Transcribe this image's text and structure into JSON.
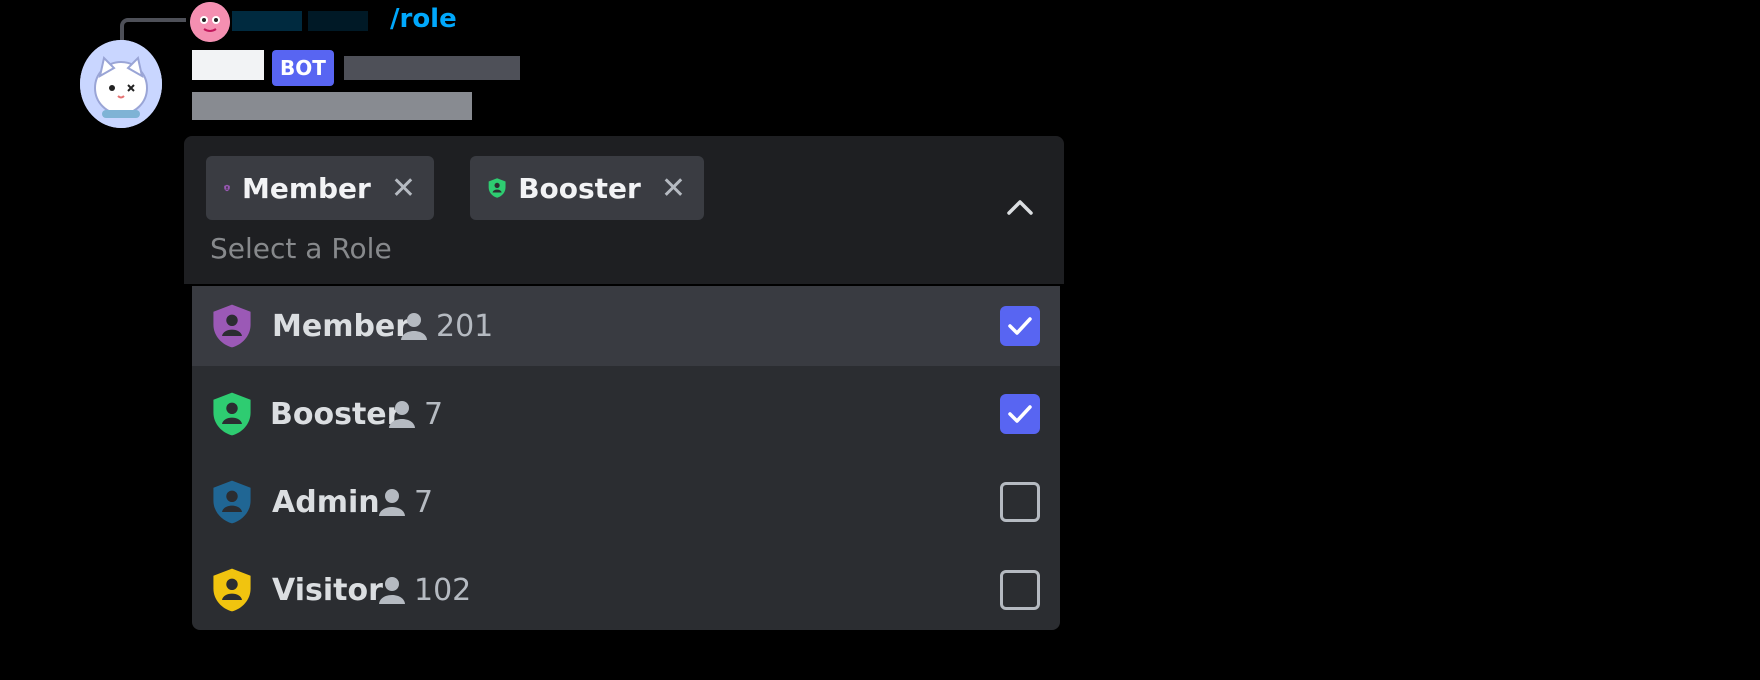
{
  "reply": {
    "command": "/role"
  },
  "message": {
    "bot_tag": "BOT"
  },
  "select": {
    "chips": [
      {
        "label": "Member",
        "color": "#9b59b6"
      },
      {
        "label": "Booster",
        "color": "#2ecc71"
      }
    ],
    "placeholder": "Select a Role",
    "remove_glyph": "✕"
  },
  "options": [
    {
      "name": "Member",
      "count": "201",
      "color": "#9b59b6",
      "checked": true
    },
    {
      "name": "Booster",
      "count": "7",
      "color": "#2ecc71",
      "checked": true
    },
    {
      "name": "Admin",
      "count": "7",
      "color": "#206694",
      "checked": false
    },
    {
      "name": "Visitor",
      "count": "102",
      "color": "#f1c40f",
      "checked": false
    }
  ],
  "icons": [
    "shield-user-icon",
    "user-icon",
    "close-icon",
    "chevron-up-icon",
    "checkmark-icon"
  ]
}
